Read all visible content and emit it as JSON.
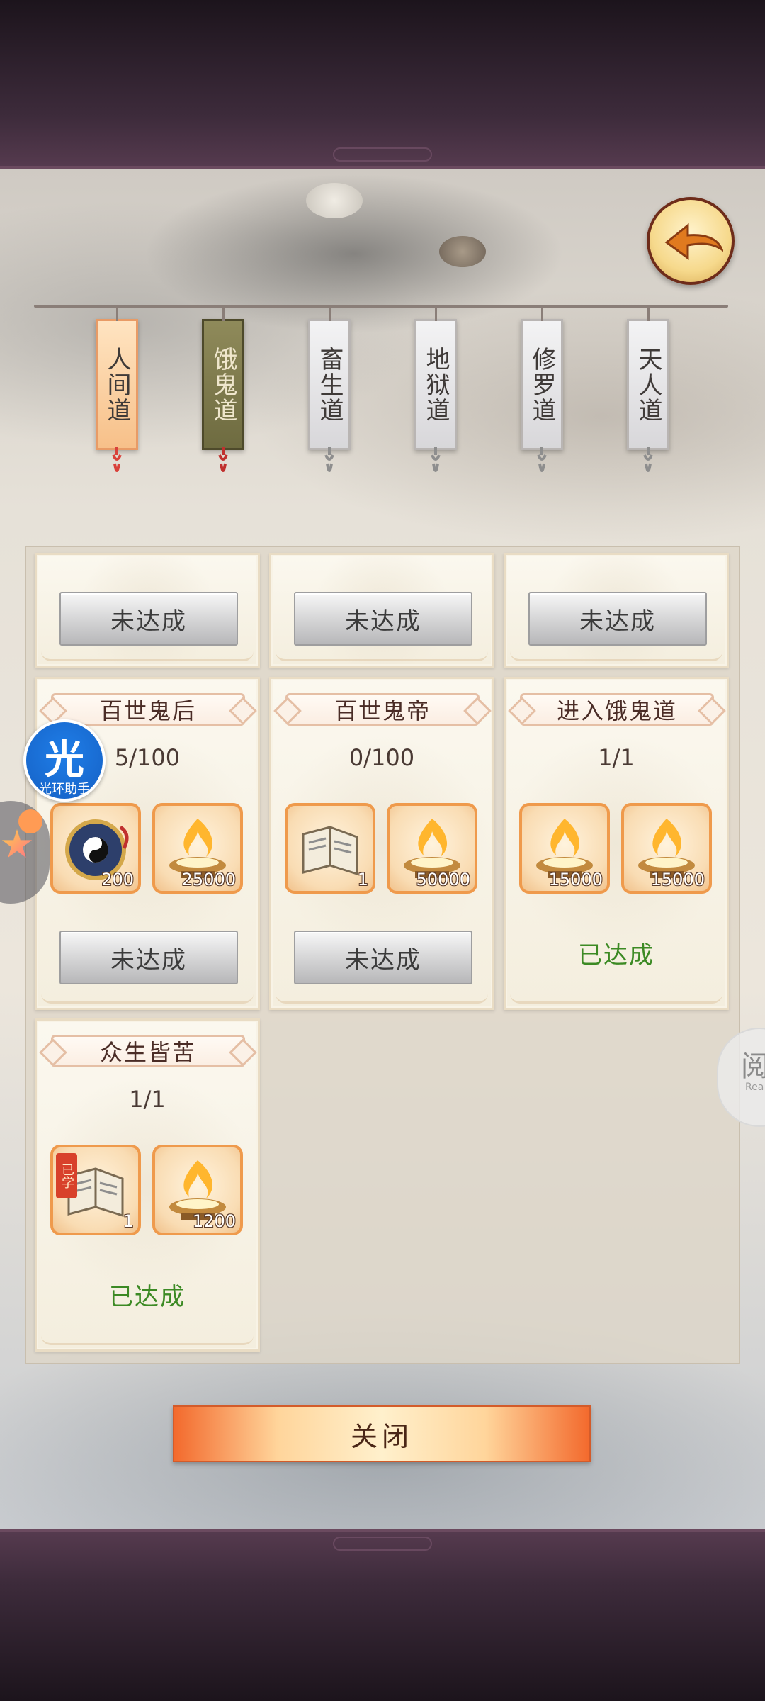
{
  "tabs": [
    {
      "label": "人间道",
      "state": "red"
    },
    {
      "label": "饿鬼道",
      "state": "olive"
    },
    {
      "label": "畜生道",
      "state": "normal"
    },
    {
      "label": "地狱道",
      "state": "normal"
    },
    {
      "label": "修罗道",
      "state": "normal"
    },
    {
      "label": "天人道",
      "state": "normal"
    }
  ],
  "top_row": [
    {
      "status": "未达成"
    },
    {
      "status": "未达成"
    },
    {
      "status": "未达成"
    }
  ],
  "cards": [
    {
      "title": "百世鬼后",
      "progress": "5/100",
      "rewards": [
        {
          "icon": "yin-yang-compass-icon",
          "qty": "200"
        },
        {
          "icon": "flame-brazier-icon",
          "qty": "25000"
        }
      ],
      "status": "未达成"
    },
    {
      "title": "百世鬼帝",
      "progress": "0/100",
      "rewards": [
        {
          "icon": "scroll-book-icon",
          "qty": "1"
        },
        {
          "icon": "flame-brazier-icon",
          "qty": "50000"
        }
      ],
      "status": "未达成"
    },
    {
      "title": "进入饿鬼道",
      "progress": "1/1",
      "rewards": [
        {
          "icon": "flame-brazier-icon",
          "qty": "15000"
        },
        {
          "icon": "flame-brazier-icon",
          "qty": "15000"
        }
      ],
      "status": "已达成"
    },
    {
      "title": "众生皆苦",
      "progress": "1/1",
      "rewards": [
        {
          "icon": "scroll-book-icon",
          "qty": "1",
          "badge": "已学"
        },
        {
          "icon": "flame-brazier-icon",
          "qty": "1200"
        }
      ],
      "status": "已达成"
    }
  ],
  "close_label": "关闭",
  "overlays": {
    "assist_char": "光",
    "assist_label": "光环助手",
    "read_char": "阅",
    "read_sub": "Rea"
  },
  "colors": {
    "achieved": "#3c8a24",
    "item_border": "#ef9a4c",
    "frame": "#3d2b3b"
  }
}
